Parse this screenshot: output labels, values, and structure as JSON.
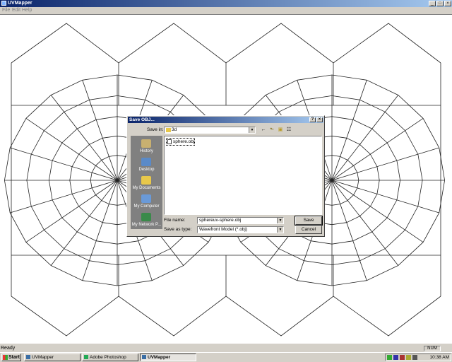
{
  "window": {
    "title": "UVMapper",
    "buttons": [
      "_",
      "□",
      "×"
    ]
  },
  "menu": {
    "items": [
      "File",
      "Edit",
      "Help"
    ]
  },
  "status": {
    "text": "Ready",
    "num": "NUM"
  },
  "taskbar": {
    "start_label": "Start",
    "tasks": [
      {
        "label": "UVMapper",
        "active": false
      },
      {
        "label": "Adobe Photoshop",
        "active": false
      },
      {
        "label": "UVMapper",
        "active": true
      }
    ],
    "clock": "10:38 AM"
  },
  "dialog": {
    "title": "Save OBJ...",
    "help_btn": "?",
    "close_btn": "×",
    "save_in_label": "Save in:",
    "save_in_value": "3d",
    "places": [
      "History",
      "Desktop",
      "My Documents",
      "My Computer",
      "My Network P..."
    ],
    "files": [
      "sphere.obj"
    ],
    "filename_label": "File name:",
    "filename_value": "sphereuv-sphere.obj",
    "savetype_label": "Save as type:",
    "savetype_value": "Wavefront Model (*.obj)",
    "save_button": "Save",
    "cancel_button": "Cancel"
  },
  "colors": {
    "title_start": "#0a246a",
    "title_end": "#a6caf0",
    "face": "#d4d0c8",
    "places_bg": "#808080"
  },
  "icons": [
    "back-arrow-icon",
    "up-folder-icon",
    "new-folder-icon",
    "view-menu-icon",
    "folder-icon",
    "file-icon"
  ]
}
